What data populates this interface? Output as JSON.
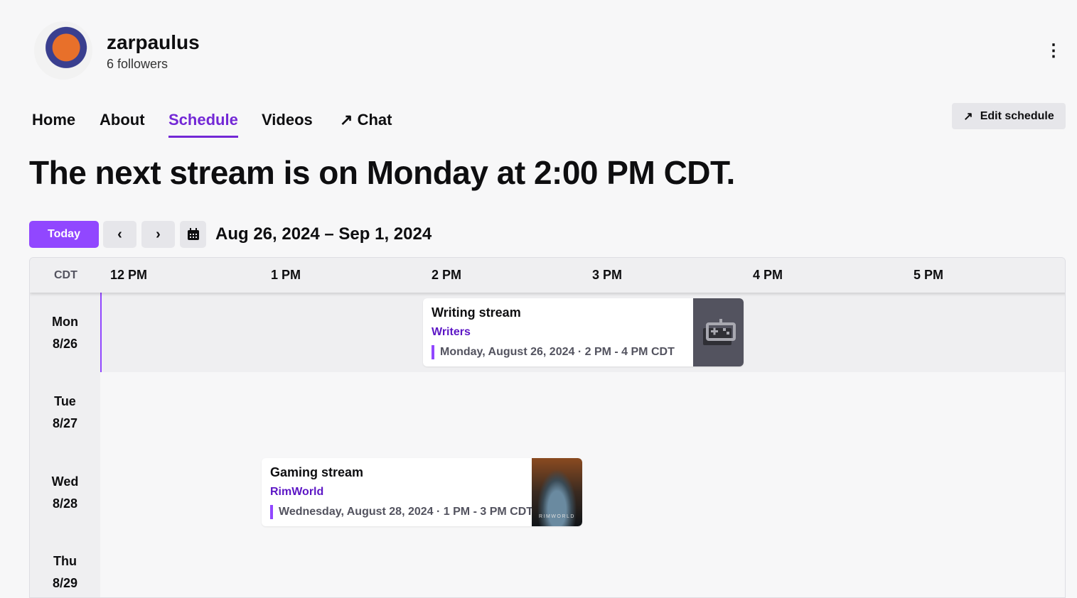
{
  "channel": {
    "name": "zarpaulus",
    "followers": "6 followers"
  },
  "nav": {
    "home": "Home",
    "about": "About",
    "schedule": "Schedule",
    "videos": "Videos",
    "chat": "Chat",
    "edit_schedule": "Edit schedule"
  },
  "headline": "The next stream is on Monday at 2:00 PM CDT.",
  "toolbar": {
    "today": "Today",
    "range": "Aug 26, 2024 – Sep 1, 2024"
  },
  "grid": {
    "timezone": "CDT",
    "hours": [
      "12 PM",
      "1 PM",
      "2 PM",
      "3 PM",
      "4 PM",
      "5 PM"
    ],
    "days": [
      {
        "name": "Mon",
        "date": "8/26"
      },
      {
        "name": "Tue",
        "date": "8/27"
      },
      {
        "name": "Wed",
        "date": "8/28"
      },
      {
        "name": "Thu",
        "date": "8/29"
      }
    ]
  },
  "events": [
    {
      "title": "Writing stream",
      "category": "Writers",
      "time": "Monday, August 26, 2024 · 2 PM - 4 PM CDT"
    },
    {
      "title": "Gaming stream",
      "category": "RimWorld",
      "time": "Wednesday, August 28, 2024 · 1 PM - 3 PM CDT",
      "art_text": "RIMWORLD"
    }
  ]
}
